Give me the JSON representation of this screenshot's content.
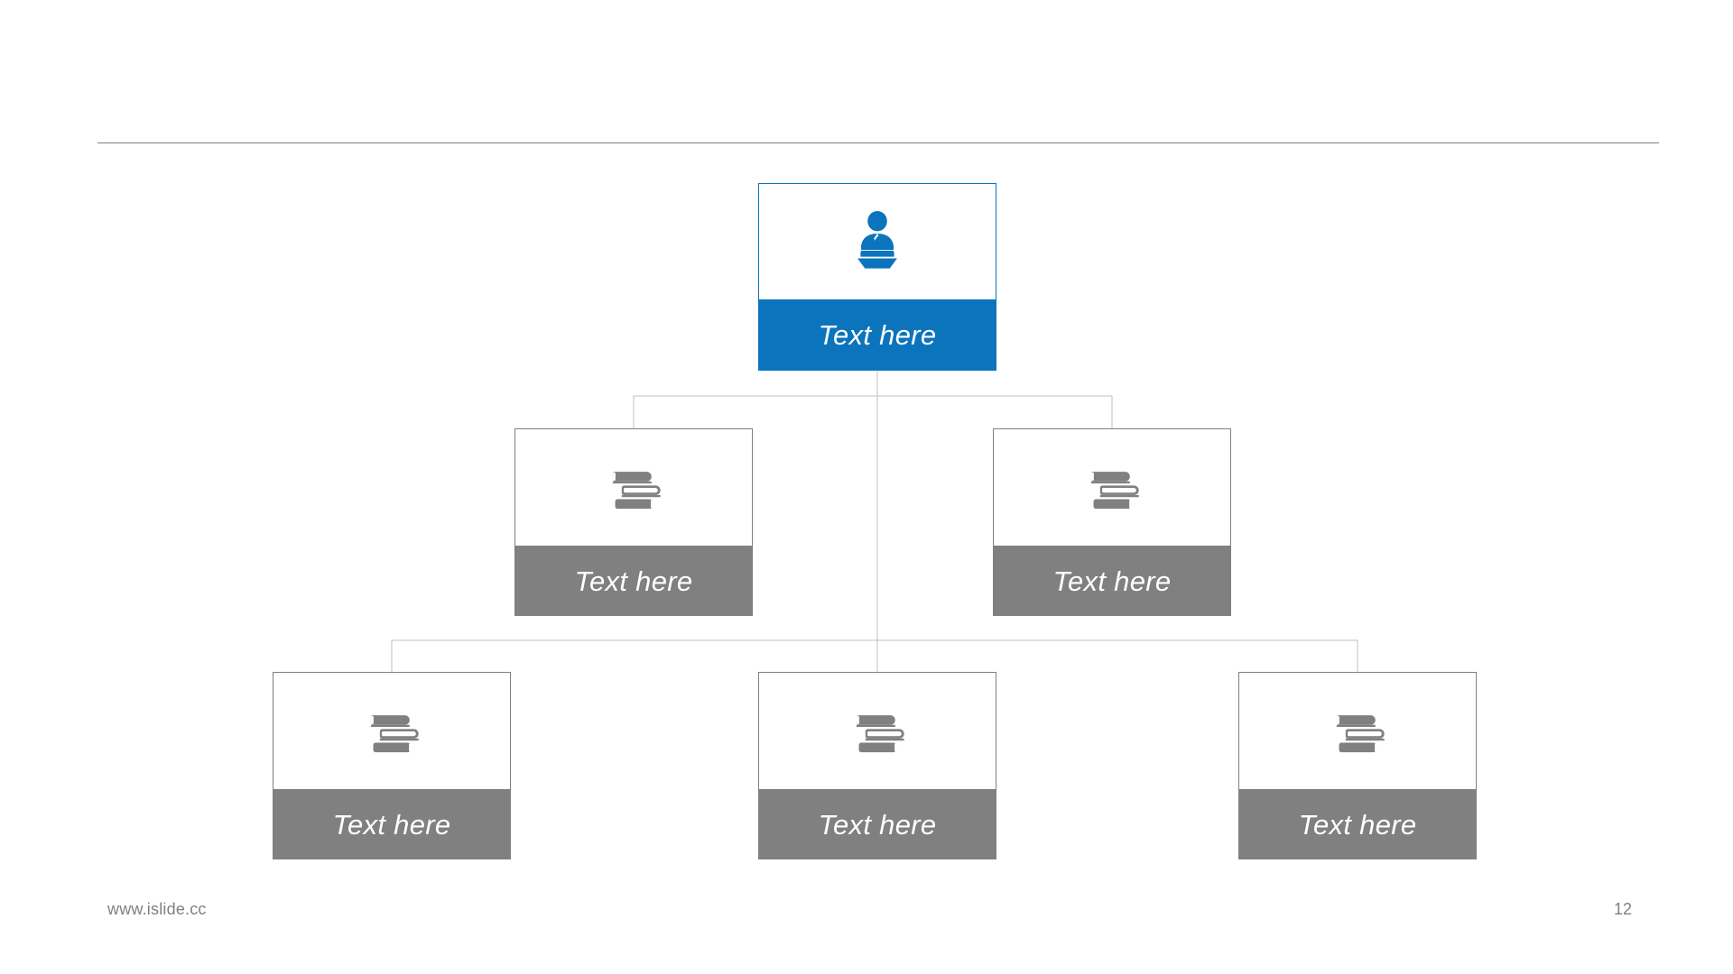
{
  "slide": {
    "page_number": "12",
    "footer_url": "www.islide.cc",
    "colors": {
      "accent_blue": "#0b74bd",
      "node_grey": "#808080",
      "connector_grey": "#bfbfbf",
      "rule_grey": "#808080",
      "card_background": "#ffffff",
      "label_text": "#ffffff"
    }
  },
  "chart_data": {
    "type": "diagram",
    "diagram_type": "organization-tree",
    "title": "",
    "levels": 3,
    "nodes": [
      {
        "id": "root",
        "level": 1,
        "label": "Text here",
        "icon": "speaker-podium-icon",
        "style": "accent",
        "children": [
          "l2-left",
          "l2-right",
          "l3-left",
          "l3-center",
          "l3-right"
        ]
      },
      {
        "id": "l2-left",
        "level": 2,
        "label": "Text here",
        "icon": "book-stack-icon",
        "style": "grey",
        "children": []
      },
      {
        "id": "l2-right",
        "level": 2,
        "label": "Text here",
        "icon": "book-stack-icon",
        "style": "grey",
        "children": []
      },
      {
        "id": "l3-left",
        "level": 3,
        "label": "Text here",
        "icon": "book-stack-icon",
        "style": "grey",
        "children": []
      },
      {
        "id": "l3-center",
        "level": 3,
        "label": "Text here",
        "icon": "book-stack-icon",
        "style": "grey",
        "children": []
      },
      {
        "id": "l3-right",
        "level": 3,
        "label": "Text here",
        "icon": "book-stack-icon",
        "style": "grey",
        "children": []
      }
    ]
  }
}
